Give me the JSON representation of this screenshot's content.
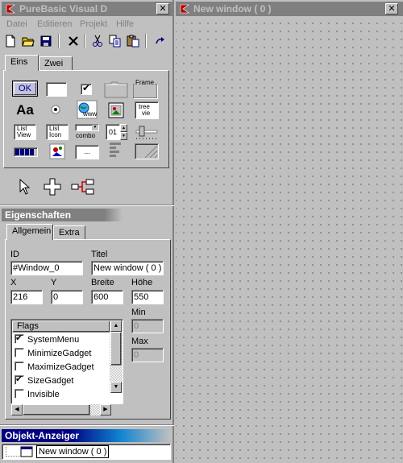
{
  "main_window": {
    "title": "PureBasic Visual D",
    "close": "✕"
  },
  "menu": [
    "Datei",
    "Editieren",
    "Projekt",
    "Hilfe"
  ],
  "toolbar": {
    "icons": [
      "new-file-icon",
      "open-folder-icon",
      "save-icon",
      "delete-icon",
      "cut-icon",
      "copy-icon",
      "paste-icon",
      "redo-icon"
    ]
  },
  "gadget_tabs": [
    "Eins",
    "Zwei"
  ],
  "gadgets": {
    "ok_label": "OK",
    "frame_label": "Frame",
    "text_label": "Aa",
    "www_label": "www",
    "tree_label": "tree",
    "tree_label2": "vie",
    "list_view_1": "List",
    "list_view_2": "View",
    "list_icon_1": "List",
    "list_icon_2": "Icon",
    "combo_label": "combo",
    "spin_label": "01",
    "browse_label": "..."
  },
  "tools": [
    "pointer-tool-icon",
    "add-gadget-icon",
    "link-gadgets-icon"
  ],
  "properties": {
    "title": "Eigenschaften",
    "tabs": [
      "Allgemein",
      "Extra"
    ],
    "id_label": "ID",
    "id_value": "#Window_0",
    "title_label": "Titel",
    "title_value": "New window ( 0 )",
    "x_label": "X",
    "x_value": "216",
    "y_label": "Y",
    "y_value": "0",
    "width_label": "Breite",
    "width_value": "600",
    "height_label": "Höhe",
    "height_value": "550",
    "min_label": "Min",
    "min_value": "0",
    "max_label": "Max",
    "max_value": "0",
    "flags_header": "Flags",
    "flags": [
      {
        "label": "SystemMenu",
        "checked": true
      },
      {
        "label": "MinimizeGadget",
        "checked": false
      },
      {
        "label": "MaximizeGadget",
        "checked": false
      },
      {
        "label": "SizeGadget",
        "checked": true
      },
      {
        "label": "Invisible",
        "checked": false
      }
    ]
  },
  "object_viewer": {
    "title": "Objekt-Anzeiger",
    "item": "New window ( 0 )"
  },
  "design_window": {
    "title": "New window ( 0 )",
    "close": "✕"
  },
  "colors": {
    "face": "#c0c0c0",
    "inactive_title": "#808080",
    "active_title": "#000080",
    "active_title_end": "#1084d0"
  }
}
